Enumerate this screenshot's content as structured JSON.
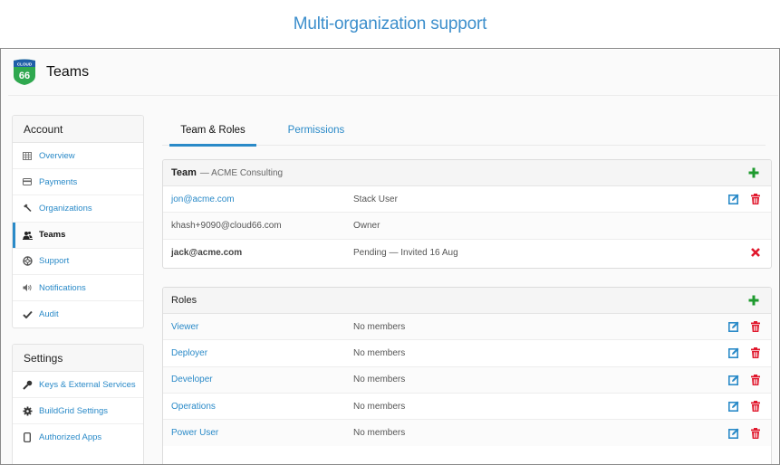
{
  "banner": {
    "title": "Multi-organization support"
  },
  "app": {
    "logo": {
      "top_text": "CLOUD",
      "bottom_text": "66"
    },
    "title": "Teams"
  },
  "sidebar": {
    "account": {
      "heading": "Account",
      "items": [
        {
          "label": "Overview",
          "icon": "grid-icon",
          "active": false
        },
        {
          "label": "Payments",
          "icon": "credit-card-icon",
          "active": false
        },
        {
          "label": "Organizations",
          "icon": "hammer-icon",
          "active": false
        },
        {
          "label": "Teams",
          "icon": "users-icon",
          "active": true
        },
        {
          "label": "Support",
          "icon": "lifebuoy-icon",
          "active": false
        },
        {
          "label": "Notifications",
          "icon": "speaker-icon",
          "active": false
        },
        {
          "label": "Audit",
          "icon": "checkmark-icon",
          "active": false
        }
      ]
    },
    "settings": {
      "heading": "Settings",
      "items": [
        {
          "label": "Keys & External Services",
          "icon": "key-icon"
        },
        {
          "label": "BuildGrid Settings",
          "icon": "gear-icon"
        },
        {
          "label": "Authorized Apps",
          "icon": "mobile-icon"
        }
      ]
    }
  },
  "tabs": [
    {
      "label": "Team & Roles",
      "active": true
    },
    {
      "label": "Permissions",
      "active": false
    }
  ],
  "team": {
    "title": "Team",
    "subtitle": "— ACME Consulting",
    "members": [
      {
        "email": "jon@acme.com",
        "role": "Stack User",
        "actions": [
          "edit",
          "delete"
        ]
      },
      {
        "email": "khash+9090@cloud66.com",
        "role": "Owner",
        "actions": []
      },
      {
        "email": "jack@acme.com",
        "role": "Pending — Invited 16 Aug",
        "actions": [
          "cancel"
        ]
      }
    ]
  },
  "roles": {
    "title": "Roles",
    "items": [
      {
        "name": "Viewer",
        "members": "No members"
      },
      {
        "name": "Deployer",
        "members": "No members"
      },
      {
        "name": "Developer",
        "members": "No members"
      },
      {
        "name": "Operations",
        "members": "No members"
      },
      {
        "name": "Power User",
        "members": "No members"
      }
    ]
  },
  "colors": {
    "link": "#2a8ac8",
    "add": "#1e9a2e",
    "delete": "#e0182d",
    "edit": "#2a8ac8",
    "banner_title": "#3d8fcc"
  }
}
